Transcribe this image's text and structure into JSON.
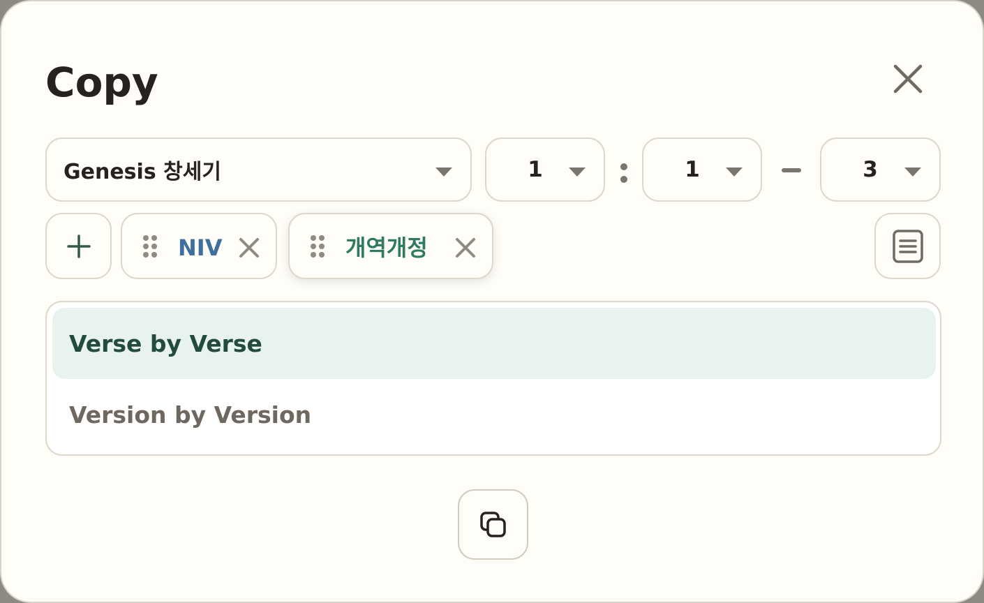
{
  "dialog": {
    "title": "Copy"
  },
  "selectors": {
    "book": "Genesis 창세기",
    "chapter": "1",
    "verse_start": "1",
    "verse_end": "3"
  },
  "versions": [
    {
      "label": "NIV",
      "color": "#3f6f9d"
    },
    {
      "label": "개역개정",
      "color": "#2f7a62"
    }
  ],
  "modes": [
    {
      "label": "Verse by Verse",
      "selected": true
    },
    {
      "label": "Version by Version",
      "selected": false
    }
  ],
  "icons": {
    "close": "close-icon",
    "add": "plus-icon",
    "drag": "drag-handle-icon",
    "remove": "x-icon",
    "format": "text-document-icon",
    "copy": "copy-icon"
  },
  "colors": {
    "background": "#fffdf7",
    "border": "#ddd7cc",
    "accent_selected_bg": "#e9f3ee",
    "accent_selected_text": "#234a3f"
  }
}
